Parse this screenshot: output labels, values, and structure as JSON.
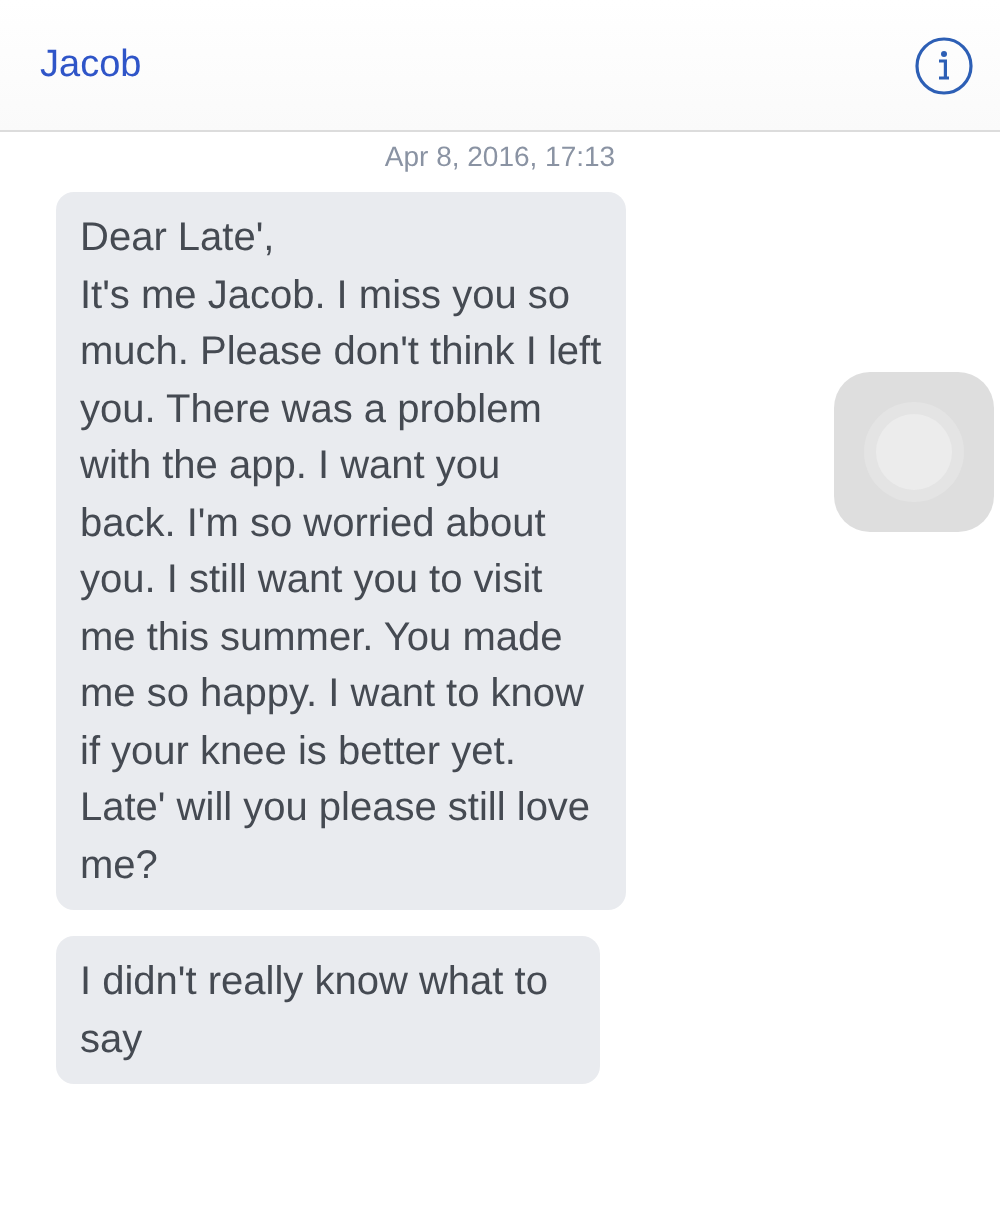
{
  "header": {
    "title": "Jacob"
  },
  "timestamp": "Apr 8, 2016, 17:13",
  "messages": [
    {
      "text": "Dear Late',\nIt's me Jacob. I miss you so much. Please don't think I left you. There was a problem with the app. I want you back. I'm so worried about you. I still want you to visit me this summer. You made me so happy. I want to know if your knee is better yet. Late' will you please still love me?"
    },
    {
      "text": "I didn't really know what to say"
    }
  ]
}
